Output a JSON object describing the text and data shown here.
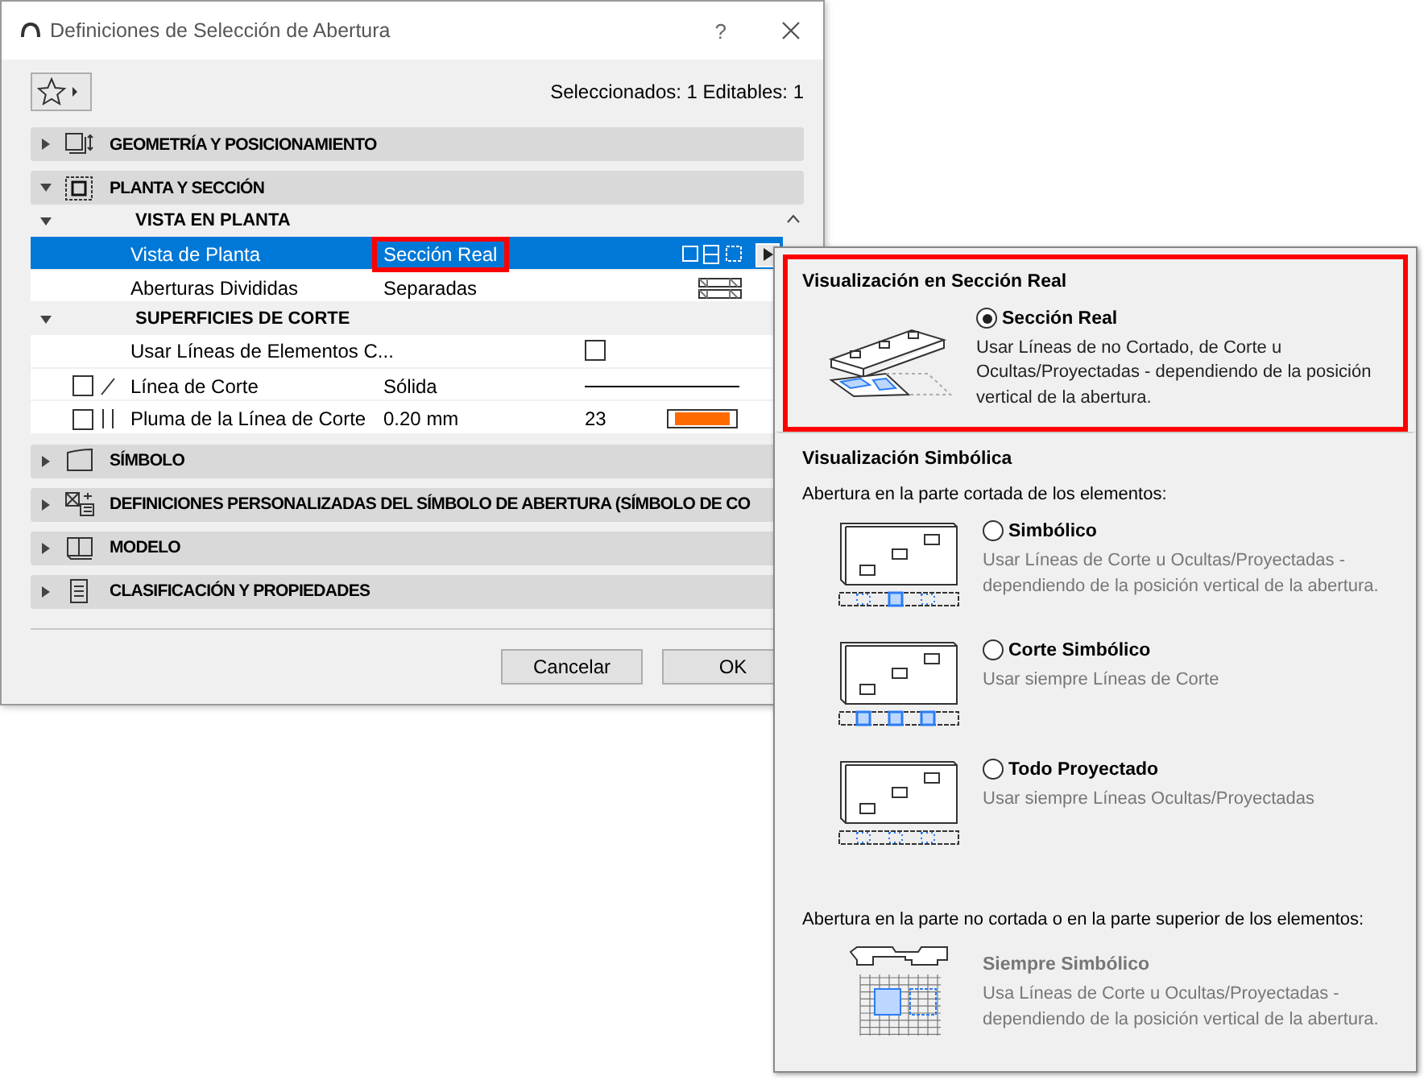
{
  "window": {
    "title": "Definiciones de Selección de Abertura",
    "help": "?"
  },
  "toolbar": {
    "status": "Seleccionados: 1 Editables: 1"
  },
  "sections": [
    {
      "kind": "geometry",
      "title": "GEOMETRÍA Y POSICIONAMIENTO",
      "expanded": false
    },
    {
      "kind": "floorplan",
      "title": "PLANTA Y SECCIÓN",
      "expanded": true,
      "groups": [
        {
          "title": "VISTA EN PLANTA",
          "expanded": true,
          "rows": [
            {
              "kind": "display-mode",
              "label": "Vista de Planta",
              "value": "Sección Real",
              "selected": true,
              "highlighted": true
            },
            {
              "kind": "split",
              "label": "Aberturas Divididas",
              "value": "Separadas",
              "selected": false,
              "highlighted": false
            }
          ]
        },
        {
          "title": "SUPERFICIES DE CORTE",
          "expanded": true,
          "rows": [
            {
              "kind": "checkbox",
              "label": "Usar Líneas de Elementos C...",
              "selected": false,
              "checked": false
            },
            {
              "kind": "line",
              "label": "Línea de Corte",
              "value": "Sólida",
              "selected": false,
              "highlighted": false,
              "linked": false
            },
            {
              "kind": "pen",
              "label": "Pluma de la Línea de Corte",
              "value": "0.20 mm",
              "pen": "23",
              "color": "#ff6a00",
              "selected": false,
              "highlighted": false,
              "linked": false
            }
          ]
        }
      ]
    },
    {
      "kind": "symbol",
      "title": "SÍMBOLO",
      "expanded": false
    },
    {
      "kind": "custom",
      "title": "DEFINICIONES PERSONALIZADAS DEL SÍMBOLO DE ABERTURA (SÍMBOLO DE CO",
      "expanded": false
    },
    {
      "kind": "model",
      "title": "MODELO",
      "expanded": false
    },
    {
      "kind": "classification",
      "title": "CLASIFICACIÓN Y PROPIEDADES",
      "expanded": false
    }
  ],
  "buttons": [
    "Cancelar",
    "OK"
  ],
  "popup": {
    "groups": [
      {
        "title": "Visualización en Sección Real",
        "highlighted": true,
        "options": [
          {
            "kind": "real",
            "label": "Sección Real",
            "description": "Usar Líneas de no Cortado, de Corte u Ocultas/Proyectadas - dependiendo de la posición vertical de la abertura.",
            "selected": true
          }
        ]
      },
      {
        "title": "Visualización Simbólica",
        "subtitle": "Abertura en la parte cortada de los elementos:",
        "highlighted": false,
        "options": [
          {
            "kind": "symbolic",
            "label": "Simbólico",
            "description": "Usar Líneas de Corte u Ocultas/Proyectadas - dependiendo de la posición vertical de la abertura.",
            "selected": false
          },
          {
            "kind": "cut",
            "label": "Corte Simbólico",
            "description": "Usar siempre Líneas de Corte",
            "selected": false
          },
          {
            "kind": "projected",
            "label": "Todo Proyectado",
            "description": "Usar siempre Líneas Ocultas/Proyectadas",
            "selected": false
          }
        ]
      },
      {
        "subtitle": "Abertura en la parte no cortada o en la parte superior de los elementos:",
        "highlighted": false,
        "options": [
          {
            "kind": "always",
            "label": "Siempre Simbólico",
            "description": "Usa Líneas de Corte u Ocultas/Proyectadas - dependiendo de la posición vertical de la abertura."
          }
        ]
      }
    ]
  }
}
